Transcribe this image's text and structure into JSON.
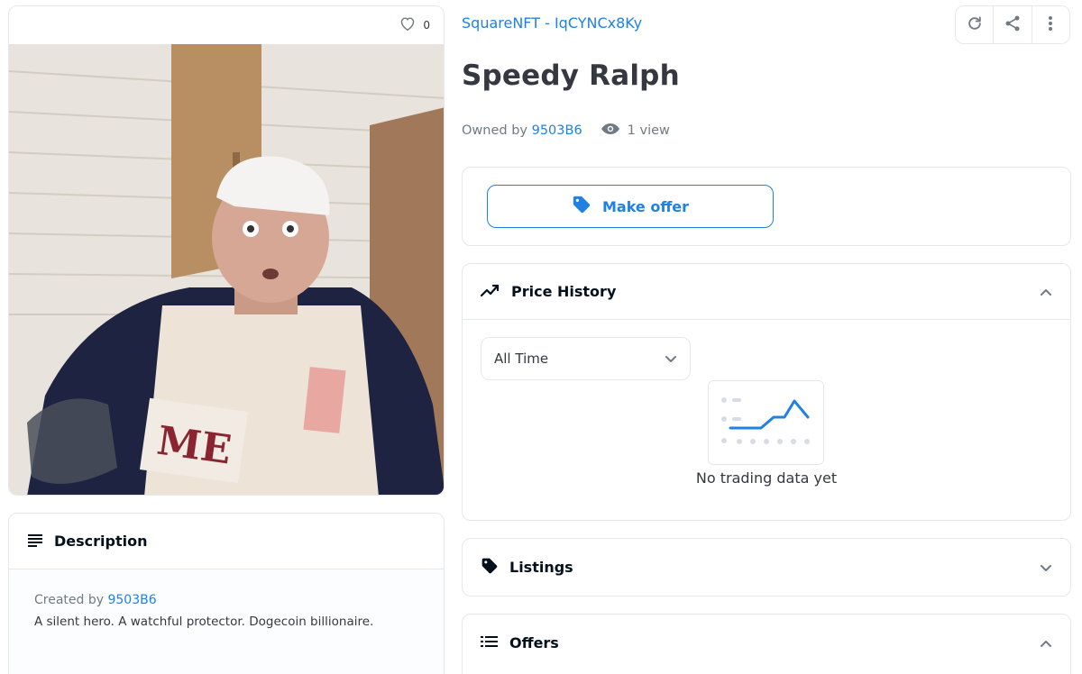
{
  "image_card": {
    "favorite_count": "0",
    "image_alt": "Speedy Ralph"
  },
  "description": {
    "title": "Description",
    "created_by_label": "Created by",
    "creator": "9503B6",
    "text": "A silent hero. A watchful protector. Dogecoin billionaire."
  },
  "item": {
    "collection": "SquareNFT - IqCYNCx8Ky",
    "name": "Speedy Ralph",
    "owned_by_label": "Owned by",
    "owner": "9503B6",
    "views": "1 view"
  },
  "toolbar": {
    "refresh_icon": "refresh-icon",
    "share_icon": "share-icon",
    "more_icon": "more-vertical-icon"
  },
  "offer": {
    "button_label": "Make offer",
    "icon": "tag-icon"
  },
  "price_history": {
    "title": "Price History",
    "icon": "trending-icon",
    "range_selected": "All Time",
    "empty_text": "No trading data yet"
  },
  "listings": {
    "title": "Listings",
    "icon": "tag-icon"
  },
  "offers": {
    "title": "Offers",
    "icon": "list-icon"
  },
  "colors": {
    "accent": "#2081e2",
    "text": "#04111d",
    "muted": "#707a83",
    "border": "#e5e8eb"
  }
}
